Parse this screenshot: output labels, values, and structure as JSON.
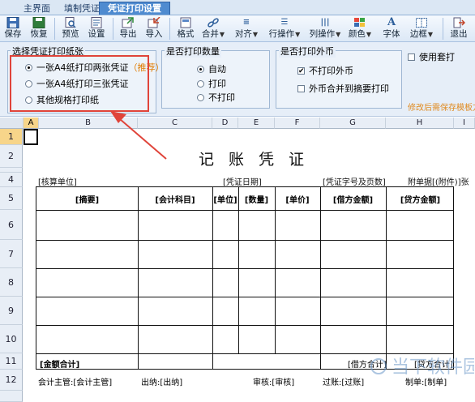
{
  "tabs": [
    {
      "label": "主界面",
      "active": false
    },
    {
      "label": "填制凭证",
      "active": false
    },
    {
      "label": "凭证打印设置",
      "active": true
    }
  ],
  "toolbar": {
    "save": "保存",
    "restore": "恢复",
    "preview": "预览",
    "settings": "设置",
    "export": "导出",
    "import": "导入",
    "format": "格式",
    "merge": "合并",
    "align": "对齐",
    "row_ops": "行操作",
    "col_ops": "列操作",
    "color": "颜色",
    "font": "字体",
    "border": "边框",
    "exit": "退出"
  },
  "paper": {
    "title": "选择凭证打印纸张",
    "options": [
      {
        "label": "一张A4纸打印两张凭证",
        "badge": "（推荐）",
        "selected": true
      },
      {
        "label": "一张A4纸打印三张凭证",
        "selected": false
      },
      {
        "label": "其他规格打印纸",
        "selected": false
      }
    ]
  },
  "count": {
    "title": "是否打印数量",
    "options": [
      {
        "label": "自动",
        "selected": true
      },
      {
        "label": "打印",
        "selected": false
      },
      {
        "label": "不打印",
        "selected": false
      }
    ]
  },
  "foreign": {
    "title": "是否打印外币",
    "options": [
      {
        "label": "不打印外币",
        "checked": true
      },
      {
        "label": "外币合并到摘要打印",
        "checked": false
      }
    ]
  },
  "template": {
    "label": "使用套打",
    "checked": false
  },
  "hint": "修改后需保存模板方",
  "grid": {
    "columns": [
      "A",
      "B",
      "C",
      "D",
      "E",
      "F",
      "G",
      "H",
      "I"
    ],
    "rows": [
      "1",
      "2",
      "3",
      "4",
      "5",
      "6",
      "7",
      "8",
      "9",
      "10",
      "11",
      "12"
    ]
  },
  "voucher": {
    "title": "记 账 凭 证",
    "unit": "[核算单位]",
    "date": "[凭证日期]",
    "voucher_no": "[凭证字号及页数]",
    "attach": "附单据[(附件)]张",
    "headers": [
      "[摘要]",
      "[会计科目]",
      "[单位]",
      "[数量]",
      "[单价]",
      "[借方金额]",
      "[贷方金额]"
    ],
    "total": "[金额合计]",
    "debit_total": "[借方合计]",
    "credit_total": "[贷方合计]",
    "signers": {
      "chief": "会计主管:[会计主管]",
      "cashier": "出纳:[出纳]",
      "auditor": "审核:[审核]",
      "poster": "过账:[过账]",
      "maker": "制单:[制单]"
    }
  },
  "watermark": "当下软件园",
  "colors": {
    "accent": "#4f8bd0",
    "highlight": "#e0443a",
    "recommend": "#e07b00"
  }
}
